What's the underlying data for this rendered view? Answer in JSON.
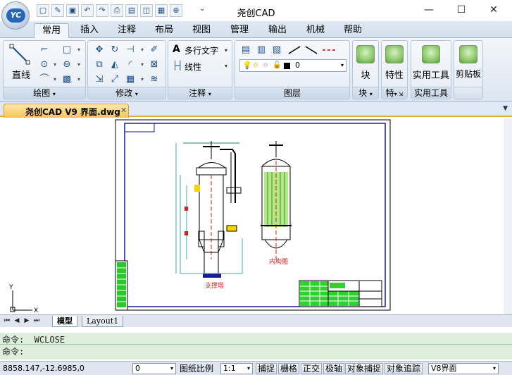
{
  "window": {
    "title": "尧创CAD",
    "logo_text": "YC",
    "minimize": "—",
    "maximize": "☐",
    "close": "✕"
  },
  "quick_access": {
    "icons": [
      "new-file-icon",
      "open-file-icon",
      "save-icon",
      "undo-icon",
      "redo-icon",
      "print-icon",
      "print-preview-icon",
      "zoom-window-icon",
      "plot-icon",
      "zoom-icon"
    ],
    "more": "⌄"
  },
  "tabs": [
    {
      "label": "常用",
      "active": true
    },
    {
      "label": "插入"
    },
    {
      "label": "注释"
    },
    {
      "label": "布局"
    },
    {
      "label": "视图"
    },
    {
      "label": "管理"
    },
    {
      "label": "输出"
    },
    {
      "label": "机械"
    },
    {
      "label": "帮助"
    }
  ],
  "ribbon": {
    "draw": {
      "label": "绘图",
      "line_label": "直线"
    },
    "modify": {
      "label": "修改"
    },
    "annotation": {
      "label": "注释",
      "mtext_label": "多行文字",
      "linear_label": "线性"
    },
    "layers": {
      "label": "图层",
      "current_layer": "0"
    },
    "block": {
      "label": "块",
      "button_label": "块"
    },
    "properties": {
      "label": "特",
      "button_label": "特性"
    },
    "utilities": {
      "label": "实用工具",
      "button_label": "实用工具"
    },
    "clipboard": {
      "button_label": "剪贴板"
    }
  },
  "document": {
    "tab_label": "尧创CAD V9 界面.dwg",
    "close": "✕",
    "pin": "▼"
  },
  "drawing": {
    "label_left": "支撑塔",
    "label_right": "内构图",
    "axis_x": "X",
    "axis_y": "Y"
  },
  "layout_tabs": [
    {
      "label": "模型",
      "active": true
    },
    {
      "label": "Layout1"
    }
  ],
  "command": {
    "line1": "命令: _WCLOSE",
    "line2": "命令:"
  },
  "status": {
    "coords": "8858.147,-12.6985,0",
    "layer_value": "0",
    "paper_scale_label": "图纸比例",
    "scale_value": "1:1",
    "buttons": [
      "捕捉",
      "栅格",
      "正交",
      "极轴",
      "对象捕捉",
      "对象追踪"
    ],
    "workspace": "V8界面"
  }
}
